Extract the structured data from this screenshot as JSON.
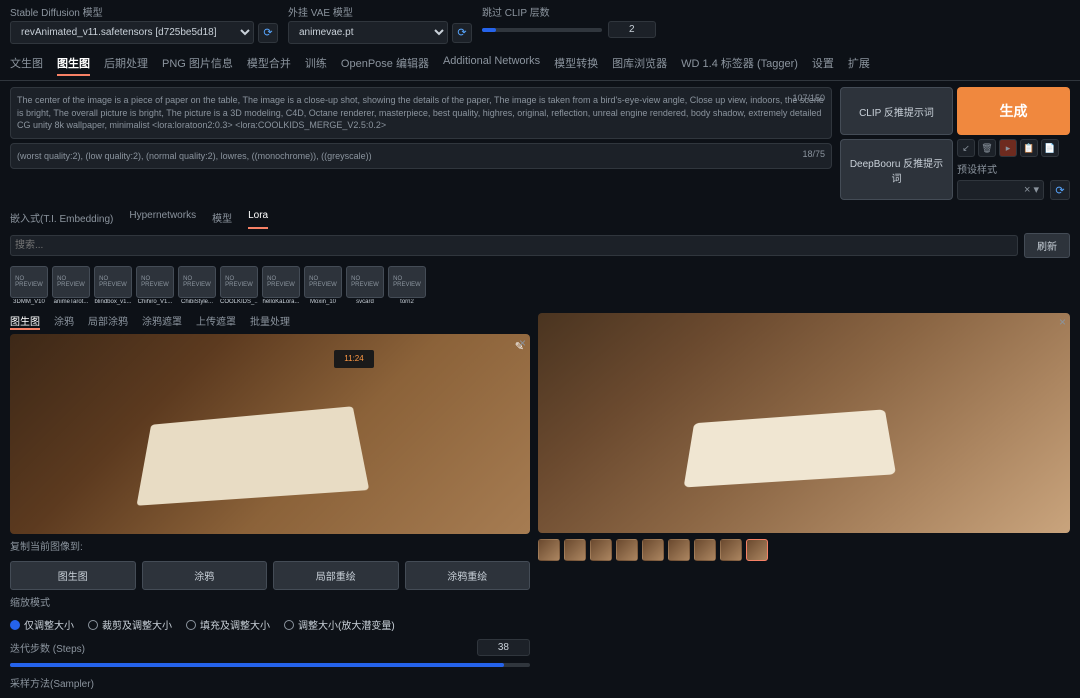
{
  "top": {
    "sd_label": "Stable Diffusion 模型",
    "sd_value": "revAnimated_v11.safetensors [d725be5d18]",
    "vae_label": "外挂 VAE 模型",
    "vae_value": "animevae.pt",
    "clip_label": "跳过 CLIP 层数",
    "clip_value": "2"
  },
  "tabs": [
    "文生图",
    "图生图",
    "后期处理",
    "PNG 图片信息",
    "模型合并",
    "训练",
    "OpenPose 编辑器",
    "Additional Networks",
    "模型转换",
    "图库浏览器",
    "WD 1.4 标签器 (Tagger)",
    "设置",
    "扩展"
  ],
  "active_tab": 1,
  "prompt": {
    "text": "The center of the image is a piece of paper on the table, The image is a close-up shot, showing the details of the paper, The image is taken from a bird's-eye-view angle, Close up view, indoors, the scene is bright, The overall picture is bright, The picture is a 3D modeling, C4D, Octane renderer, masterpiece, best quality, highres, original, reflection, unreal engine rendered, body shadow, extremely detailed CG unity 8k wallpaper, minimalist <lora:loratoon2:0.3> <lora:COOLKIDS_MERGE_V2.5:0.2>",
    "counter": "107/150"
  },
  "neg_prompt": {
    "text": "(worst quality:2), (low quality:2), (normal quality:2), lowres, ((monochrome)), ((greyscale))",
    "counter": "18/75"
  },
  "buttons": {
    "clip": "CLIP    反推提示词",
    "deepbooru": "DeepBooru 反推提示词",
    "generate": "生成",
    "style_label": "预设样式"
  },
  "sub_tabs": [
    "嵌入式(T.I. Embedding)",
    "Hypernetworks",
    "模型",
    "Lora"
  ],
  "sub_active": 3,
  "lora_search": "搜索...",
  "lora_refresh": "刷新",
  "loras": [
    "3DMM_V10",
    "animeTarot...",
    "blindbox_v1...",
    "Chihiro_V1...",
    "ChibiStyle...",
    "COOLKIDS_...",
    "helloKaLora...",
    "Moxin_10",
    "svcard",
    "torn2"
  ],
  "img_tabs": [
    "图生图",
    "涂鸦",
    "局部涂鸦",
    "涂鸦遮罩",
    "上传遮罩",
    "批量处理"
  ],
  "img_active": 0,
  "clock_time": "11:24",
  "drop_label": "复制当前图像到:",
  "actions": [
    "图生图",
    "涂鸦",
    "局部重绘",
    "涂鸦重绘"
  ],
  "resize_label": "缩放模式",
  "resize_opts": [
    "仅调整大小",
    "裁剪及调整大小",
    "填充及调整大小",
    "调整大小(放大潜变量)"
  ],
  "steps_label": "迭代步数 (Steps)",
  "steps_value": "38",
  "sampler_label": "采样方法(Sampler)",
  "thumb_count": 9
}
